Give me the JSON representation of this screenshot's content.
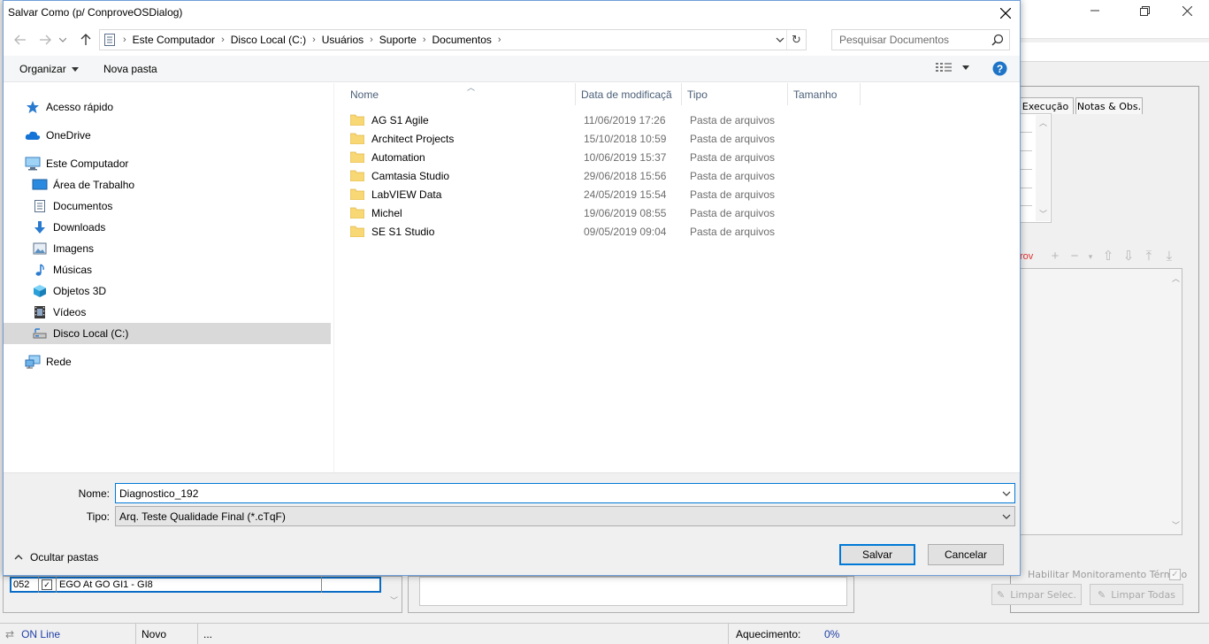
{
  "dialog": {
    "title": "Salvar Como (p/ ConproveOSDialog)",
    "breadcrumb": [
      "Este Computador",
      "Disco Local (C:)",
      "Usuários",
      "Suporte",
      "Documentos"
    ],
    "search_placeholder": "Pesquisar Documentos",
    "toolbar": {
      "organize": "Organizar",
      "new_folder": "Nova pasta"
    },
    "nav": {
      "quick_access": "Acesso rápido",
      "onedrive": "OneDrive",
      "this_pc": "Este Computador",
      "desktop": "Área de Trabalho",
      "documents": "Documentos",
      "downloads": "Downloads",
      "pictures": "Imagens",
      "music": "Músicas",
      "objects3d": "Objetos 3D",
      "videos": "Vídeos",
      "local_disk": "Disco Local (C:)",
      "network": "Rede"
    },
    "columns": {
      "name": "Nome",
      "date": "Data de modificaçã",
      "type": "Tipo",
      "size": "Tamanho"
    },
    "files": [
      {
        "name": "AG S1 Agile",
        "date": "11/06/2019 17:26",
        "type": "Pasta de arquivos"
      },
      {
        "name": "Architect Projects",
        "date": "15/10/2018 10:59",
        "type": "Pasta de arquivos"
      },
      {
        "name": "Automation",
        "date": "10/06/2019 15:37",
        "type": "Pasta de arquivos"
      },
      {
        "name": "Camtasia Studio",
        "date": "29/06/2018 15:56",
        "type": "Pasta de arquivos"
      },
      {
        "name": "LabVIEW Data",
        "date": "24/05/2019 15:54",
        "type": "Pasta de arquivos"
      },
      {
        "name": "Michel",
        "date": "19/06/2019 08:55",
        "type": "Pasta de arquivos"
      },
      {
        "name": "SE S1 Studio",
        "date": "09/05/2019 09:04",
        "type": "Pasta de arquivos"
      }
    ],
    "filename_label": "Nome:",
    "filename_value": "Diagnostico_192",
    "filetype_label": "Tipo:",
    "filetype_value": "Arq. Teste Qualidade Final (*.cTqF)",
    "save_button": "Salvar",
    "cancel_button": "Cancelar",
    "hide_folders": "Ocultar pastas"
  },
  "background": {
    "tabs": [
      "Execução",
      "Notas & Obs."
    ],
    "error_label": "rov",
    "monitor_label": "Habilitar Monitoramento Térmico",
    "clear_selected": "Limpar Selec.",
    "clear_all": "Limpar Todas",
    "row": {
      "id": "052",
      "label": "EGO At GO GI1 - GI8"
    },
    "status": {
      "online": "ON Line",
      "mode": "Novo",
      "extra": "...",
      "heating_label": "Aquecimento:",
      "heating_value": "0%"
    }
  },
  "colors": {
    "accent": "#0078d7",
    "folder": "#f8d775",
    "help": "#1e74c6",
    "error": "#e03030"
  }
}
